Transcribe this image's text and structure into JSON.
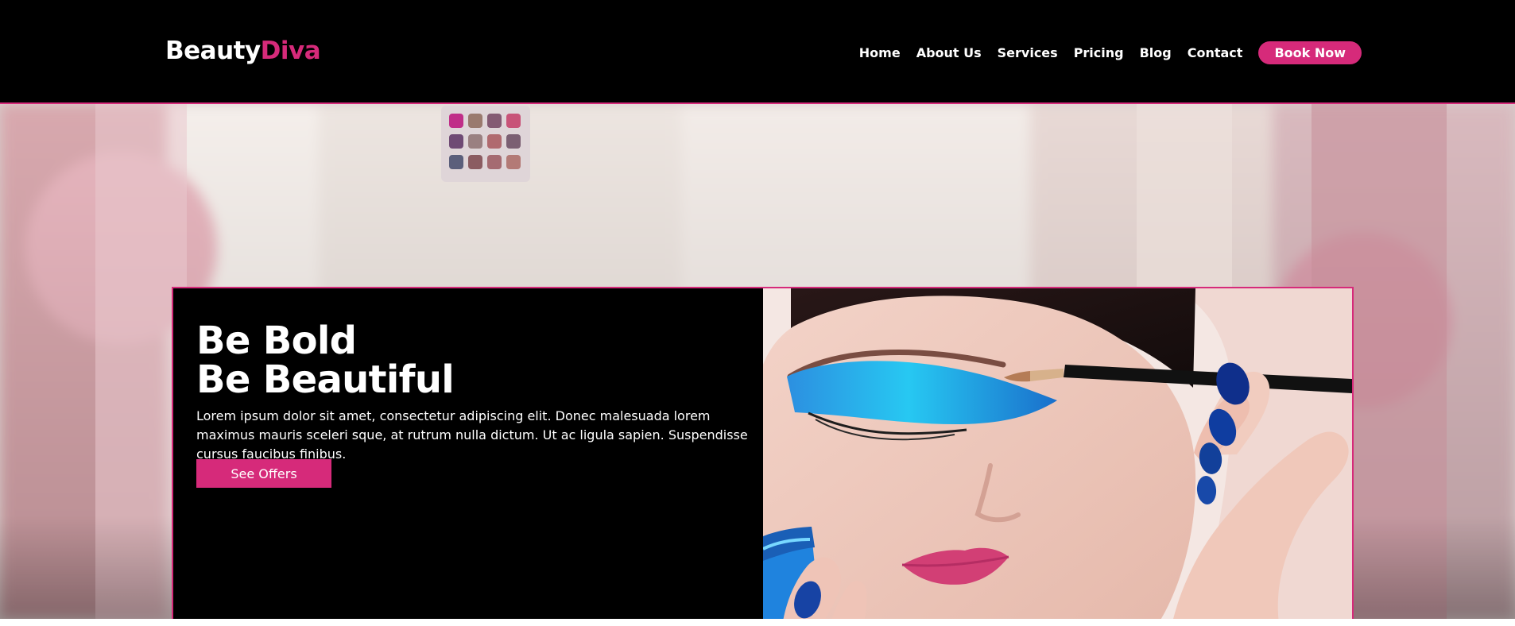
{
  "header": {
    "logo": {
      "primary": "Beauty",
      "accent": "Diva"
    },
    "nav": [
      {
        "label": "Home"
      },
      {
        "label": "About Us"
      },
      {
        "label": "Services"
      },
      {
        "label": "Pricing"
      },
      {
        "label": "Blog"
      },
      {
        "label": "Contact"
      }
    ],
    "cta": {
      "label": "Book Now"
    }
  },
  "hero": {
    "title_line_1": "Be Bold",
    "title_line_2": "Be Beautiful",
    "description": "Lorem ipsum dolor sit amet, consectetur adipiscing elit. Donec malesuada lorem maximus mauris sceleri sque, at rutrum nulla dictum. Ut ac ligula sapien. Suspendisse cursus faucibus finibus.",
    "button_label": "See Offers"
  },
  "colors": {
    "brand": "#d62a7a",
    "header_bg": "#000000",
    "card_bg": "#000000",
    "text": "#ffffff"
  },
  "icons": {
    "logo": "beautydiva-logo",
    "portrait_image": "makeup-portrait"
  }
}
